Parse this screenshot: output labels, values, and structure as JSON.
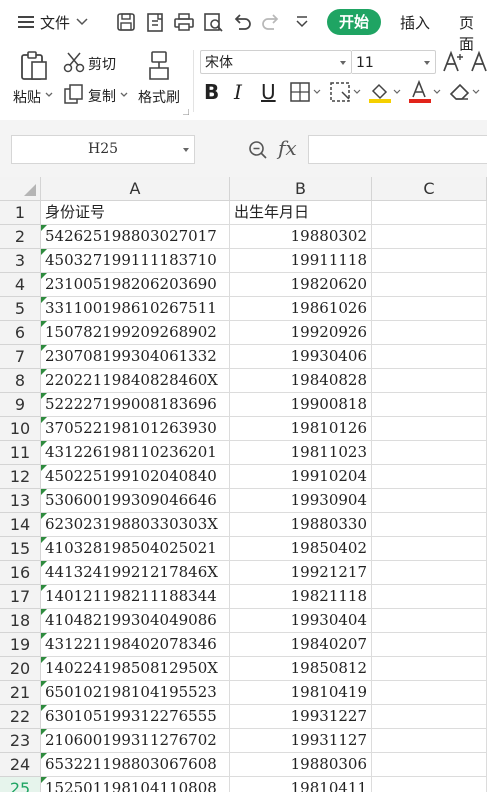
{
  "menu": {
    "file_label": "文件",
    "tabs": {
      "start": "开始",
      "insert": "插入",
      "page": "页面"
    }
  },
  "ribbon": {
    "paste_label": "粘贴",
    "cut_label": "剪切",
    "copy_label": "复制",
    "format_painter_label": "格式刷",
    "font_name": "宋体",
    "font_size": "11"
  },
  "formula_bar": {
    "name_box": "H25",
    "fx_label": "fx",
    "formula": ""
  },
  "sheet": {
    "columns": [
      "A",
      "B",
      "C"
    ],
    "rows": [
      {
        "n": "1",
        "a": "身份证号",
        "b": "出生年月日"
      },
      {
        "n": "2",
        "a": "542625198803027017",
        "b": "19880302"
      },
      {
        "n": "3",
        "a": "450327199111183710",
        "b": "19911118"
      },
      {
        "n": "4",
        "a": "231005198206203690",
        "b": "19820620"
      },
      {
        "n": "5",
        "a": "331100198610267511",
        "b": "19861026"
      },
      {
        "n": "6",
        "a": "150782199209268902",
        "b": "19920926"
      },
      {
        "n": "7",
        "a": "230708199304061332",
        "b": "19930406"
      },
      {
        "n": "8",
        "a": "22022119840828460X",
        "b": "19840828"
      },
      {
        "n": "9",
        "a": "522227199008183696",
        "b": "19900818"
      },
      {
        "n": "10",
        "a": "370522198101263930",
        "b": "19810126"
      },
      {
        "n": "11",
        "a": "431226198110236201",
        "b": "19811023"
      },
      {
        "n": "12",
        "a": "450225199102040840",
        "b": "19910204"
      },
      {
        "n": "13",
        "a": "530600199309046646",
        "b": "19930904"
      },
      {
        "n": "14",
        "a": "62302319880330303X",
        "b": "19880330"
      },
      {
        "n": "15",
        "a": "410328198504025021",
        "b": "19850402"
      },
      {
        "n": "16",
        "a": "44132419921217846X",
        "b": "19921217"
      },
      {
        "n": "17",
        "a": "140121198211188344",
        "b": "19821118"
      },
      {
        "n": "18",
        "a": "410482199304049086",
        "b": "19930404"
      },
      {
        "n": "19",
        "a": "431221198402078346",
        "b": "19840207"
      },
      {
        "n": "20",
        "a": "14022419850812950X",
        "b": "19850812"
      },
      {
        "n": "21",
        "a": "650102198104195523",
        "b": "19810419"
      },
      {
        "n": "22",
        "a": "630105199312276555",
        "b": "19931227"
      },
      {
        "n": "23",
        "a": "210600199311276702",
        "b": "19931127"
      },
      {
        "n": "24",
        "a": "653221198803067608",
        "b": "19880306"
      },
      {
        "n": "25",
        "a": "152501198104110808",
        "b": "19810411"
      }
    ],
    "active_row": "25"
  },
  "colors": {
    "accent": "#1fa463",
    "error_marker": "#2e8b3e"
  }
}
